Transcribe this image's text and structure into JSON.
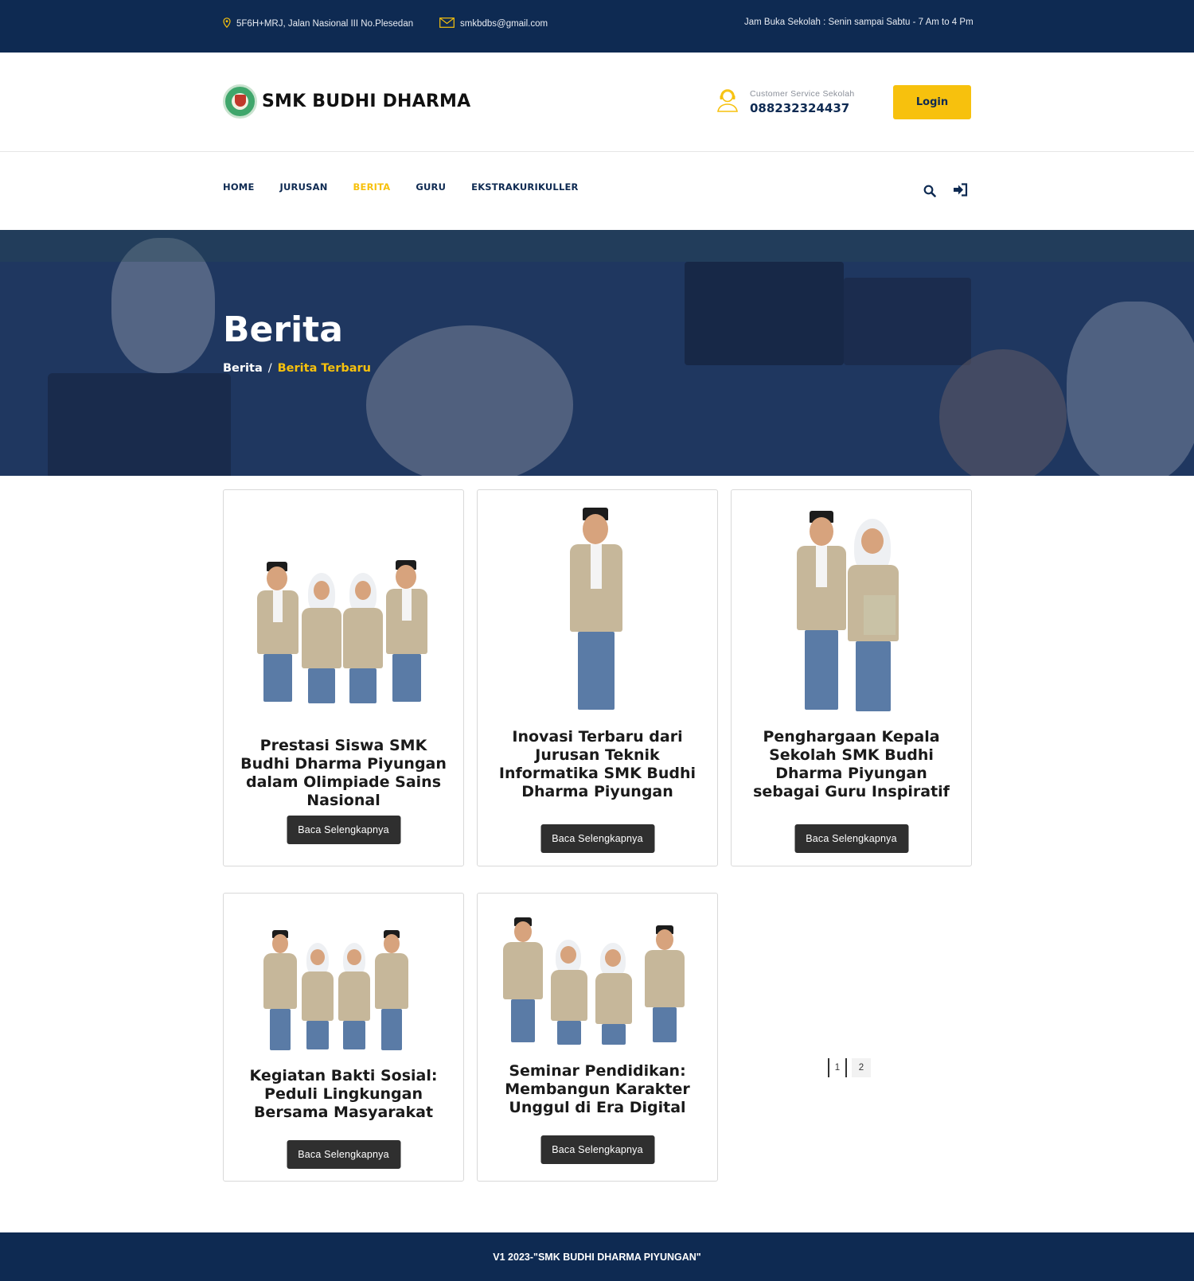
{
  "topbar": {
    "address": "5F6H+MRJ, Jalan Nasional III No.Plesedan",
    "email": "smkbdbs@gmail.com",
    "hours": "Jam Buka Sekolah : Senin sampai Sabtu - 7 Am to 4 Pm",
    "icons": [
      "map-pin-icon",
      "mail-icon"
    ],
    "accent_color": "#f7c10d",
    "bg_color": "#0e2a52"
  },
  "header": {
    "school_name": "SMK BUDHI DHARMA",
    "cs_label": "Customer Service Sekolah",
    "cs_phone": "088232324437",
    "login_label": "Login"
  },
  "nav": {
    "items": [
      {
        "label": "HOME",
        "active": false
      },
      {
        "label": "JURUSAN",
        "active": false
      },
      {
        "label": "BERITA",
        "active": true
      },
      {
        "label": "GURU",
        "active": false
      },
      {
        "label": "EKSTRAKURIKULLER",
        "active": false
      }
    ],
    "icons": [
      "search-icon",
      "sign-in-icon"
    ]
  },
  "banner": {
    "title": "Berita",
    "breadcrumb_root": "Berita",
    "breadcrumb_sep": "/",
    "breadcrumb_current": "Berita Terbaru"
  },
  "cards": [
    {
      "title": "Prestasi Siswa SMK Budhi Dharma Piyungan dalam Olimpiade Sains Nasional",
      "button": "Baca Selengkapnya"
    },
    {
      "title": "Inovasi Terbaru dari Jurusan Teknik Informatika SMK Budhi Dharma Piyungan",
      "button": "Baca Selengkapnya"
    },
    {
      "title": "Penghargaan Kepala Sekolah SMK Budhi Dharma Piyungan sebagai Guru Inspiratif",
      "button": "Baca Selengkapnya"
    },
    {
      "title": "Kegiatan Bakti Sosial: Peduli Lingkungan Bersama Masyarakat",
      "button": "Baca Selengkapnya"
    },
    {
      "title": "Seminar Pendidikan: Membangun Karakter Unggul di Era Digital",
      "button": "Baca Selengkapnya"
    }
  ],
  "pagination": {
    "pages": [
      "1",
      "2"
    ],
    "current": "1"
  },
  "footer": {
    "text": "V1 2023-\"SMK BUDHI DHARMA PIYUNGAN\""
  }
}
